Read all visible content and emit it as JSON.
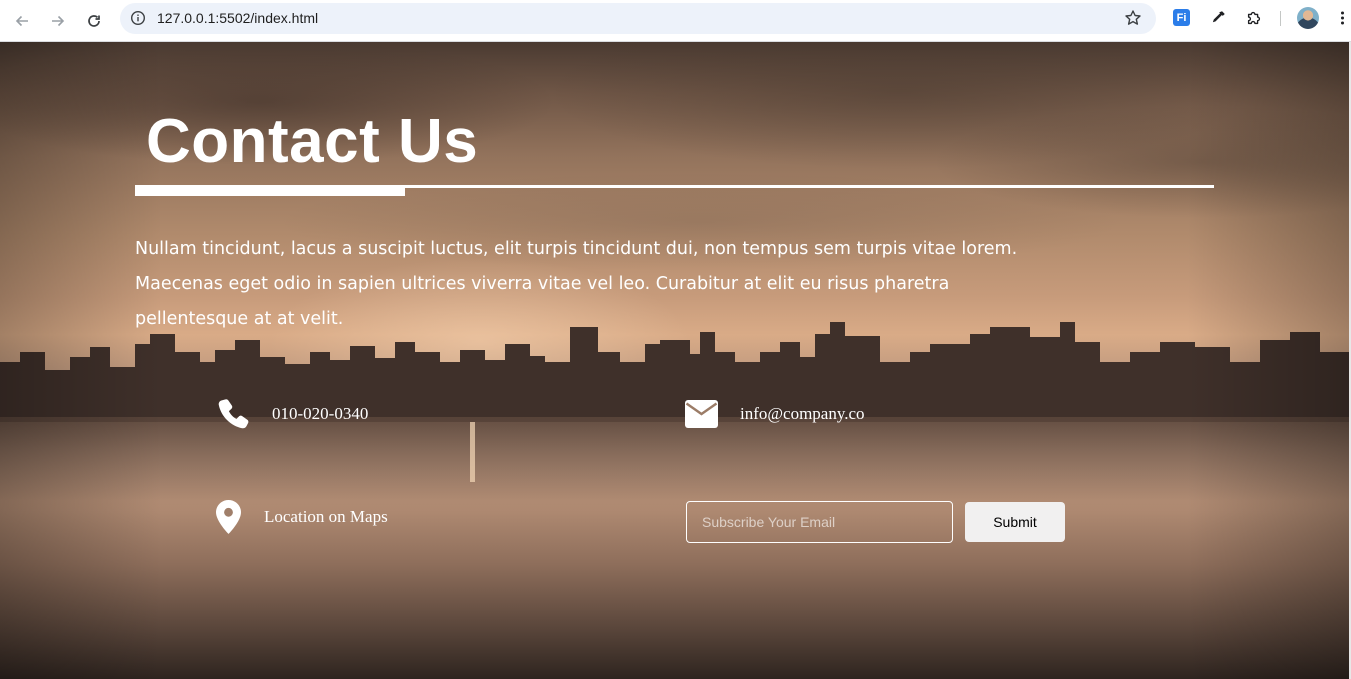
{
  "browser": {
    "url": "127.0.0.1:5502/index.html",
    "extension_label": "Fi",
    "icons": [
      "back-arrow-icon",
      "forward-arrow-icon",
      "reload-icon",
      "site-info-icon",
      "bookmark-star-icon",
      "eyedropper-icon",
      "extensions-puzzle-icon",
      "profile-avatar",
      "menu-kebab-icon"
    ]
  },
  "page": {
    "title": "Contact Us",
    "description": "Nullam tincidunt, lacus a suscipit luctus, elit turpis tincidunt dui, non tempus sem turpis vitae lorem. Maecenas eget odio in sapien ultrices viverra vitae vel leo. Curabitur at elit eu risus pharetra pellentesque at at velit.",
    "contacts": {
      "phone": "010-020-0340",
      "email": "info@company.co",
      "location": "Location on Maps"
    },
    "subscribe": {
      "placeholder": "Subscribe Your Email",
      "value": "",
      "button_label": "Submit"
    }
  }
}
